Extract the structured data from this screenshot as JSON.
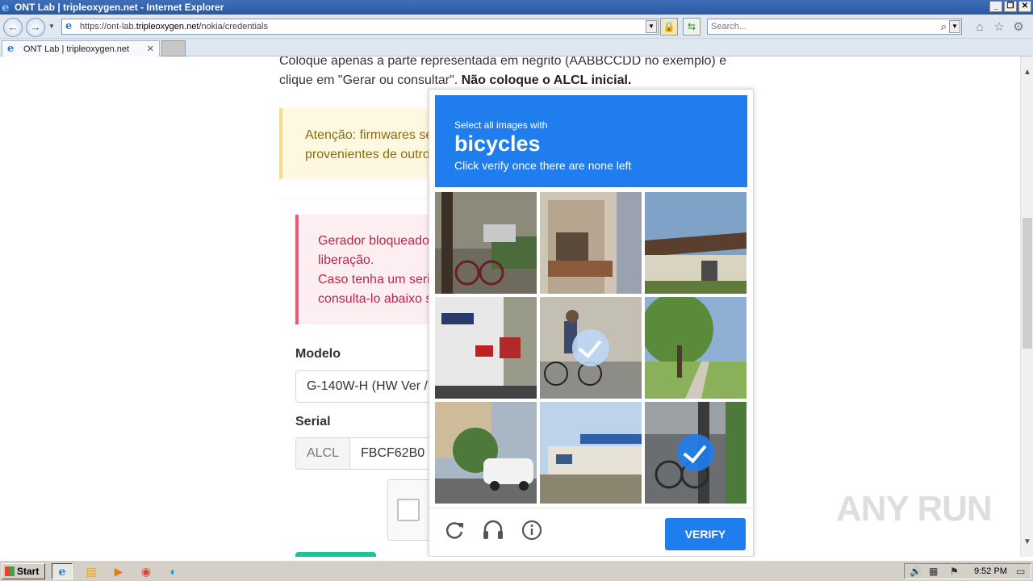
{
  "window": {
    "title": "ONT Lab | tripleoxygen.net - Internet Explorer"
  },
  "address": {
    "prefix": "https://ont-lab.",
    "domain": "tripleoxygen.net",
    "path": "/nokia/credentials"
  },
  "search": {
    "placeholder": "Search..."
  },
  "tab": {
    "label": "ONT Lab | tripleoxygen.net"
  },
  "page": {
    "intro_line1": "Coloque apenas a parte representada em negrito (AABBCCDD no exemplo) e",
    "intro_line2": "clique em \"Gerar ou consultar\". ",
    "intro_bold": "Não coloque o ALCL inicial.",
    "warning_line1": "Atenção: firmwares ser",
    "warning_line2": "provenientes de outro",
    "error_line1": "Gerador bloqueado",
    "error_line2": "liberação.",
    "error_line3": "Caso tenha um seria",
    "error_line4": "consulta-lo abaixo s",
    "model_label": "Modelo",
    "model_value": "G-140W-H (HW Ver /",
    "serial_label": "Serial",
    "serial_prefix": "ALCL",
    "serial_value": "FBCF62B0"
  },
  "captcha": {
    "prompt": "Select all images with",
    "subject": "bicycles",
    "instruction": "Click verify once there are none left",
    "tiles": [
      {
        "name": "tile-bicycle-street",
        "selected": false
      },
      {
        "name": "tile-balcony",
        "selected": false
      },
      {
        "name": "tile-house-roof",
        "selected": false
      },
      {
        "name": "tile-bus",
        "selected": false
      },
      {
        "name": "tile-cyclist-road",
        "selected": true
      },
      {
        "name": "tile-tree-sidewalk",
        "selected": false
      },
      {
        "name": "tile-street-car",
        "selected": false
      },
      {
        "name": "tile-building-sky",
        "selected": false
      },
      {
        "name": "tile-bicycle-pole",
        "selected": true
      }
    ],
    "verify_label": "VERIFY"
  },
  "watermark": "ANY RUN",
  "taskbar": {
    "start_label": "Start",
    "clock": "9:52 PM"
  },
  "colors": {
    "accent": "#1f7ded",
    "warning_text": "#8a6d0b",
    "error_text": "#b8284b",
    "success": "#1cc29c"
  }
}
